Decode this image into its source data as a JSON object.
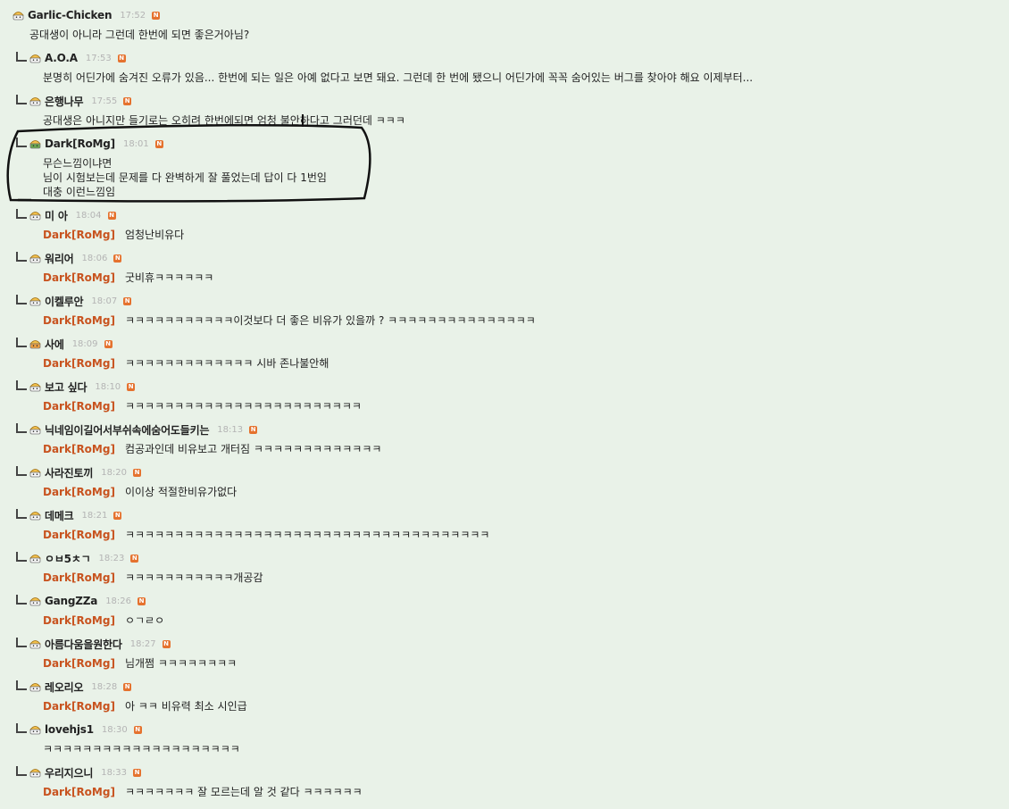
{
  "comments": [
    {
      "nick": "Garlic-Chicken",
      "time": "17:52",
      "badge": "N",
      "lines": [
        "공대생이 아니라 그런데 한번에 되면 좋은거아님?"
      ],
      "mention": "",
      "reply": false,
      "avatar": "basic"
    },
    {
      "nick": "A.O.A",
      "time": "17:53",
      "badge": "N",
      "lines": [
        "분명히 어딘가에 숨겨진 오류가 있음... 한번에 되는 일은 아예 없다고 보면 돼요. 그런데 한 번에 됐으니 어딘가에 꼭꼭 숨어있는 버그를 찾아야 해요 이제부터..."
      ],
      "mention": "",
      "reply": true,
      "avatar": "basic"
    },
    {
      "nick": "은행나무",
      "time": "17:55",
      "badge": "N",
      "lines": [
        "공대생은 아니지만 들기로는 오히려 한번에되면 엄청 불안하다고 그러던데 ㅋㅋㅋ"
      ],
      "mention": "",
      "reply": true,
      "avatar": "basic"
    },
    {
      "nick": "Dark[RoMg]",
      "time": "18:01",
      "badge": "N",
      "lines": [
        "무슨느낌이냐면",
        "님이 시험보는데 문제를 다 완벽하게 잘 풀었는데 답이 다 1번임",
        "대충 이런느낌임"
      ],
      "mention": "",
      "reply": true,
      "avatar": "green"
    },
    {
      "nick": "미 아",
      "time": "18:04",
      "badge": "N",
      "lines": [
        "엄청난비유다"
      ],
      "mention": "Dark[RoMg]",
      "reply": true,
      "avatar": "basic"
    },
    {
      "nick": "워리어",
      "time": "18:06",
      "badge": "N",
      "lines": [
        "굿비휴ㅋㅋㅋㅋㅋㅋ"
      ],
      "mention": "Dark[RoMg]",
      "reply": true,
      "avatar": "basic"
    },
    {
      "nick": "이켈루안",
      "time": "18:07",
      "badge": "N",
      "lines": [
        "ㅋㅋㅋㅋㅋㅋㅋㅋㅋㅋㅋ이것보다 더 좋은 비유가 있을까 ? ㅋㅋㅋㅋㅋㅋㅋㅋㅋㅋㅋㅋㅋㅋㅋ"
      ],
      "mention": "Dark[RoMg]",
      "reply": true,
      "avatar": "basic"
    },
    {
      "nick": "사에",
      "time": "18:09",
      "badge": "N",
      "lines": [
        "ㅋㅋㅋㅋㅋㅋㅋㅋㅋㅋㅋㅋㅋ 시바 존나불안해"
      ],
      "mention": "Dark[RoMg]",
      "reply": true,
      "avatar": "orange"
    },
    {
      "nick": "보고 싶다",
      "time": "18:10",
      "badge": "N",
      "lines": [
        "ㅋㅋㅋㅋㅋㅋㅋㅋㅋㅋㅋㅋㅋㅋㅋㅋㅋㅋㅋㅋㅋㅋㅋㅋ"
      ],
      "mention": "Dark[RoMg]",
      "reply": true,
      "avatar": "basic"
    },
    {
      "nick": "닉네임이길어서부쉬속에숨어도들키는",
      "time": "18:13",
      "badge": "N",
      "lines": [
        "컴공과인데 비유보고 개터짐 ㅋㅋㅋㅋㅋㅋㅋㅋㅋㅋㅋㅋㅋ"
      ],
      "mention": "Dark[RoMg]",
      "reply": true,
      "avatar": "basic"
    },
    {
      "nick": "사라진토끼",
      "time": "18:20",
      "badge": "N",
      "lines": [
        "이이상 적절한비유가없다"
      ],
      "mention": "Dark[RoMg]",
      "reply": true,
      "avatar": "basic"
    },
    {
      "nick": "데메크",
      "time": "18:21",
      "badge": "N",
      "lines": [
        "ㅋㅋㅋㅋㅋㅋㅋㅋㅋㅋㅋㅋㅋㅋㅋㅋㅋㅋㅋㅋㅋㅋㅋㅋㅋㅋㅋㅋㅋㅋㅋㅋㅋㅋㅋㅋㅋ"
      ],
      "mention": "Dark[RoMg]",
      "reply": true,
      "avatar": "basic"
    },
    {
      "nick": "ㅇㅂ5ㅊㄱ",
      "time": "18:23",
      "badge": "N",
      "lines": [
        "ㅋㅋㅋㅋㅋㅋㅋㅋㅋㅋㅋ개공감"
      ],
      "mention": "Dark[RoMg]",
      "reply": true,
      "avatar": "basic"
    },
    {
      "nick": "GangZZa",
      "time": "18:26",
      "badge": "N",
      "lines": [
        "ㅇㄱㄹㅇ"
      ],
      "mention": "Dark[RoMg]",
      "reply": true,
      "avatar": "basic"
    },
    {
      "nick": "아름다움을원한다",
      "time": "18:27",
      "badge": "N",
      "lines": [
        "님개쩜 ㅋㅋㅋㅋㅋㅋㅋㅋ"
      ],
      "mention": "Dark[RoMg]",
      "reply": true,
      "avatar": "basic"
    },
    {
      "nick": "레오리오",
      "time": "18:28",
      "badge": "N",
      "lines": [
        "아 ㅋㅋ 비유력 최소 시인급"
      ],
      "mention": "Dark[RoMg]",
      "reply": true,
      "avatar": "basic"
    },
    {
      "nick": "lovehjs1",
      "time": "18:30",
      "badge": "N",
      "lines": [
        "ㅋㅋㅋㅋㅋㅋㅋㅋㅋㅋㅋㅋㅋㅋㅋㅋㅋㅋㅋㅋ"
      ],
      "mention": "",
      "reply": true,
      "avatar": "basic"
    },
    {
      "nick": "우리지으니",
      "time": "18:33",
      "badge": "N",
      "lines": [
        "ㅋㅋㅋㅋㅋㅋㅋ 잘 모르는데 알 것 같다 ㅋㅋㅋㅋㅋㅋ"
      ],
      "mention": "Dark[RoMg]",
      "reply": true,
      "avatar": "basic"
    }
  ],
  "colors": {
    "background": "#e9f2e8",
    "mention": "#c8531f",
    "badge": "#e5722e",
    "timestamp": "#b4b4b4",
    "annotation": "#111111"
  }
}
